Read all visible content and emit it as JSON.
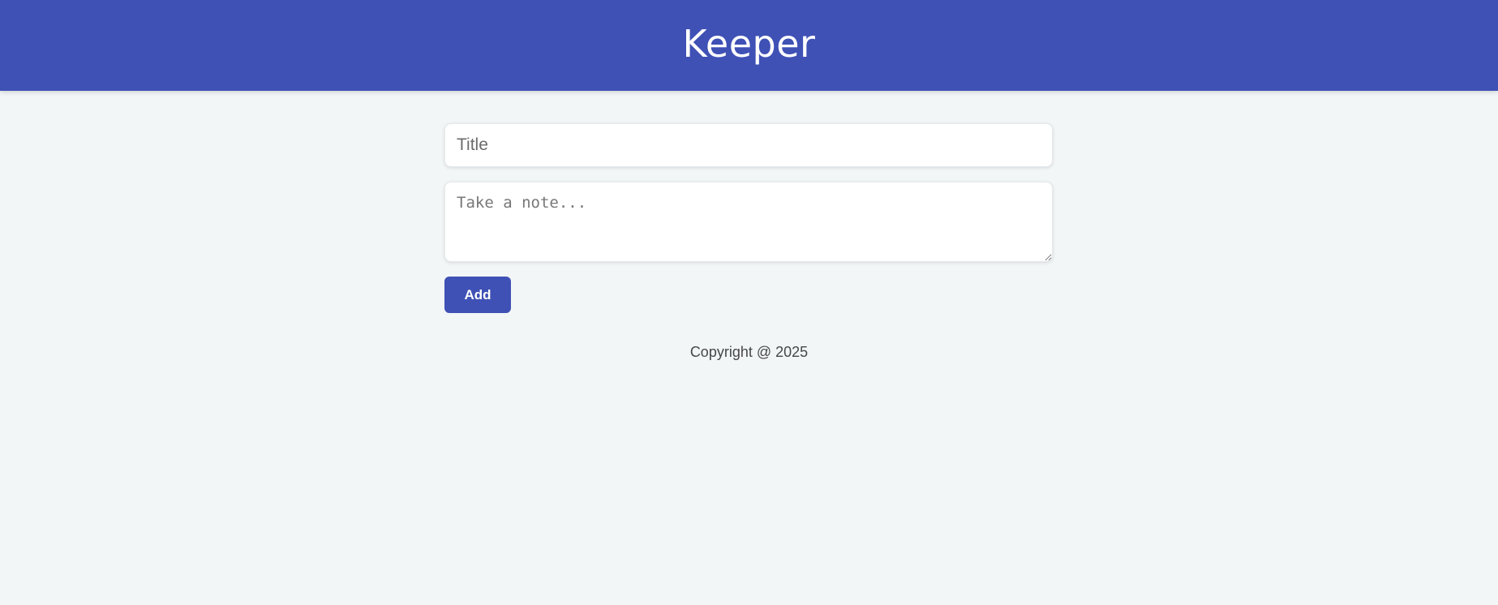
{
  "header": {
    "title": "Keeper"
  },
  "form": {
    "title_input": {
      "placeholder": "Title",
      "value": ""
    },
    "note_textarea": {
      "placeholder": "Take a note...",
      "value": ""
    },
    "add_button_label": "Add"
  },
  "footer": {
    "text": "Copyright @ 2025"
  },
  "colors": {
    "primary": "#3f51b5",
    "background": "#f2f6f7"
  }
}
